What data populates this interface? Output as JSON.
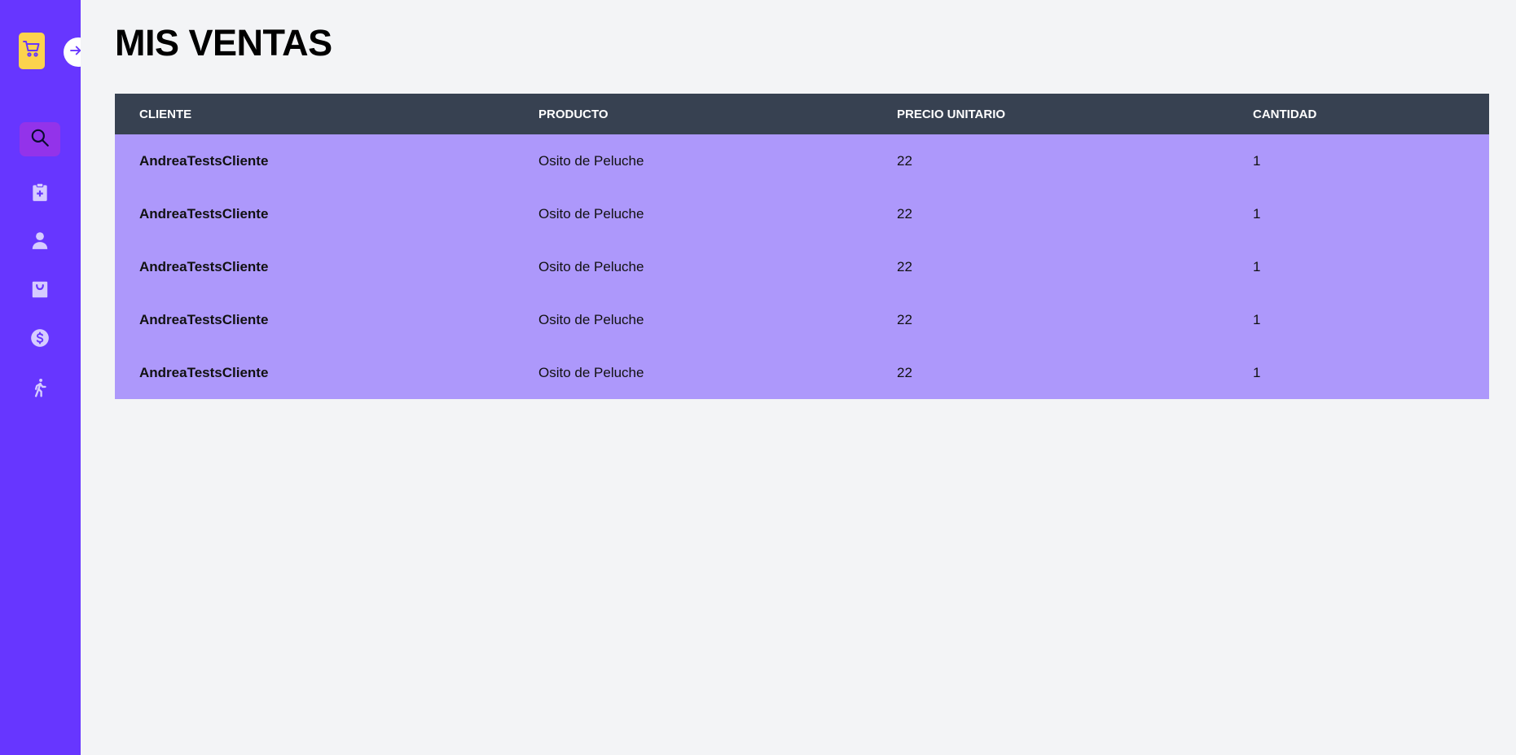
{
  "page": {
    "title": "MIS VENTAS"
  },
  "sidebar": {
    "logo_icon": "shopping-cart-icon",
    "toggle_icon": "arrow-right-icon",
    "items": [
      {
        "icon": "search-icon",
        "active": true
      },
      {
        "icon": "clipboard-plus-icon",
        "active": false
      },
      {
        "icon": "user-icon",
        "active": false
      },
      {
        "icon": "shopping-bag-icon",
        "active": false
      },
      {
        "icon": "dollar-circle-icon",
        "active": false
      },
      {
        "icon": "walking-person-icon",
        "active": false
      }
    ]
  },
  "table": {
    "headers": [
      "CLIENTE",
      "PRODUCTO",
      "PRECIO UNITARIO",
      "CANTIDAD"
    ],
    "rows": [
      [
        "AndreaTestsCliente",
        "Osito de Peluche",
        "22",
        "1"
      ],
      [
        "AndreaTestsCliente",
        "Osito de Peluche",
        "22",
        "1"
      ],
      [
        "AndreaTestsCliente",
        "Osito de Peluche",
        "22",
        "1"
      ],
      [
        "AndreaTestsCliente",
        "Osito de Peluche",
        "22",
        "1"
      ],
      [
        "AndreaTestsCliente",
        "Osito de Peluche",
        "22",
        "1"
      ]
    ]
  },
  "colors": {
    "sidebar": "#6736ff",
    "active_item": "#9333ea",
    "logo_bg": "#fcd34d",
    "header_bg": "#374151",
    "row_bg": "#ad98fb"
  }
}
